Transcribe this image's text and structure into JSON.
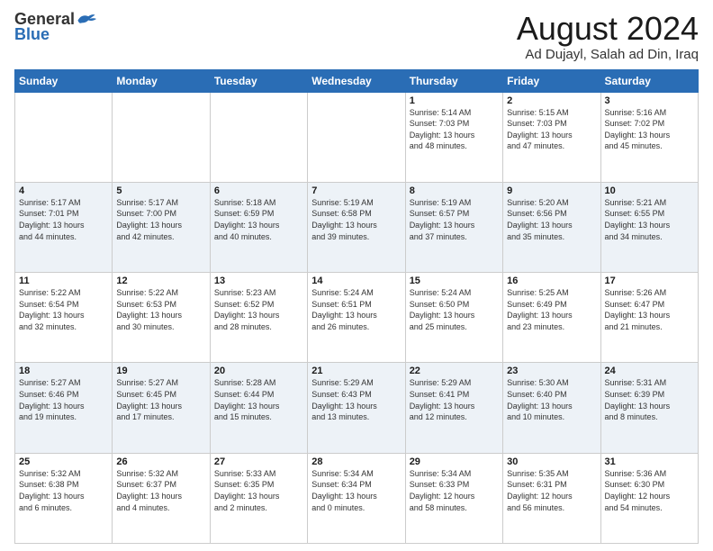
{
  "logo": {
    "general": "General",
    "blue": "Blue"
  },
  "title": "August 2024",
  "subtitle": "Ad Dujayl, Salah ad Din, Iraq",
  "days_of_week": [
    "Sunday",
    "Monday",
    "Tuesday",
    "Wednesday",
    "Thursday",
    "Friday",
    "Saturday"
  ],
  "weeks": [
    [
      {
        "day": "",
        "info": ""
      },
      {
        "day": "",
        "info": ""
      },
      {
        "day": "",
        "info": ""
      },
      {
        "day": "",
        "info": ""
      },
      {
        "day": "1",
        "info": "Sunrise: 5:14 AM\nSunset: 7:03 PM\nDaylight: 13 hours\nand 48 minutes."
      },
      {
        "day": "2",
        "info": "Sunrise: 5:15 AM\nSunset: 7:03 PM\nDaylight: 13 hours\nand 47 minutes."
      },
      {
        "day": "3",
        "info": "Sunrise: 5:16 AM\nSunset: 7:02 PM\nDaylight: 13 hours\nand 45 minutes."
      }
    ],
    [
      {
        "day": "4",
        "info": "Sunrise: 5:17 AM\nSunset: 7:01 PM\nDaylight: 13 hours\nand 44 minutes."
      },
      {
        "day": "5",
        "info": "Sunrise: 5:17 AM\nSunset: 7:00 PM\nDaylight: 13 hours\nand 42 minutes."
      },
      {
        "day": "6",
        "info": "Sunrise: 5:18 AM\nSunset: 6:59 PM\nDaylight: 13 hours\nand 40 minutes."
      },
      {
        "day": "7",
        "info": "Sunrise: 5:19 AM\nSunset: 6:58 PM\nDaylight: 13 hours\nand 39 minutes."
      },
      {
        "day": "8",
        "info": "Sunrise: 5:19 AM\nSunset: 6:57 PM\nDaylight: 13 hours\nand 37 minutes."
      },
      {
        "day": "9",
        "info": "Sunrise: 5:20 AM\nSunset: 6:56 PM\nDaylight: 13 hours\nand 35 minutes."
      },
      {
        "day": "10",
        "info": "Sunrise: 5:21 AM\nSunset: 6:55 PM\nDaylight: 13 hours\nand 34 minutes."
      }
    ],
    [
      {
        "day": "11",
        "info": "Sunrise: 5:22 AM\nSunset: 6:54 PM\nDaylight: 13 hours\nand 32 minutes."
      },
      {
        "day": "12",
        "info": "Sunrise: 5:22 AM\nSunset: 6:53 PM\nDaylight: 13 hours\nand 30 minutes."
      },
      {
        "day": "13",
        "info": "Sunrise: 5:23 AM\nSunset: 6:52 PM\nDaylight: 13 hours\nand 28 minutes."
      },
      {
        "day": "14",
        "info": "Sunrise: 5:24 AM\nSunset: 6:51 PM\nDaylight: 13 hours\nand 26 minutes."
      },
      {
        "day": "15",
        "info": "Sunrise: 5:24 AM\nSunset: 6:50 PM\nDaylight: 13 hours\nand 25 minutes."
      },
      {
        "day": "16",
        "info": "Sunrise: 5:25 AM\nSunset: 6:49 PM\nDaylight: 13 hours\nand 23 minutes."
      },
      {
        "day": "17",
        "info": "Sunrise: 5:26 AM\nSunset: 6:47 PM\nDaylight: 13 hours\nand 21 minutes."
      }
    ],
    [
      {
        "day": "18",
        "info": "Sunrise: 5:27 AM\nSunset: 6:46 PM\nDaylight: 13 hours\nand 19 minutes."
      },
      {
        "day": "19",
        "info": "Sunrise: 5:27 AM\nSunset: 6:45 PM\nDaylight: 13 hours\nand 17 minutes."
      },
      {
        "day": "20",
        "info": "Sunrise: 5:28 AM\nSunset: 6:44 PM\nDaylight: 13 hours\nand 15 minutes."
      },
      {
        "day": "21",
        "info": "Sunrise: 5:29 AM\nSunset: 6:43 PM\nDaylight: 13 hours\nand 13 minutes."
      },
      {
        "day": "22",
        "info": "Sunrise: 5:29 AM\nSunset: 6:41 PM\nDaylight: 13 hours\nand 12 minutes."
      },
      {
        "day": "23",
        "info": "Sunrise: 5:30 AM\nSunset: 6:40 PM\nDaylight: 13 hours\nand 10 minutes."
      },
      {
        "day": "24",
        "info": "Sunrise: 5:31 AM\nSunset: 6:39 PM\nDaylight: 13 hours\nand 8 minutes."
      }
    ],
    [
      {
        "day": "25",
        "info": "Sunrise: 5:32 AM\nSunset: 6:38 PM\nDaylight: 13 hours\nand 6 minutes."
      },
      {
        "day": "26",
        "info": "Sunrise: 5:32 AM\nSunset: 6:37 PM\nDaylight: 13 hours\nand 4 minutes."
      },
      {
        "day": "27",
        "info": "Sunrise: 5:33 AM\nSunset: 6:35 PM\nDaylight: 13 hours\nand 2 minutes."
      },
      {
        "day": "28",
        "info": "Sunrise: 5:34 AM\nSunset: 6:34 PM\nDaylight: 13 hours\nand 0 minutes."
      },
      {
        "day": "29",
        "info": "Sunrise: 5:34 AM\nSunset: 6:33 PM\nDaylight: 12 hours\nand 58 minutes."
      },
      {
        "day": "30",
        "info": "Sunrise: 5:35 AM\nSunset: 6:31 PM\nDaylight: 12 hours\nand 56 minutes."
      },
      {
        "day": "31",
        "info": "Sunrise: 5:36 AM\nSunset: 6:30 PM\nDaylight: 12 hours\nand 54 minutes."
      }
    ]
  ]
}
